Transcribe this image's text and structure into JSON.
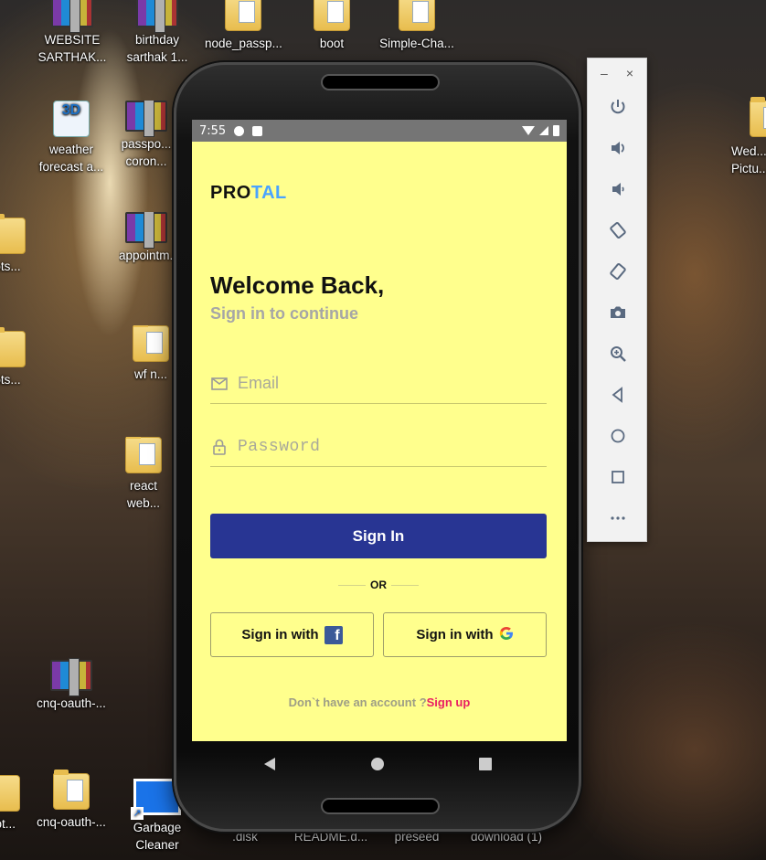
{
  "desktop": {
    "icons": [
      {
        "label": "WEBSITE SARTHAK...",
        "type": "rar"
      },
      {
        "label": "birthday sarthak 1...",
        "type": "rar"
      },
      {
        "label": "node_passp...",
        "type": "folder"
      },
      {
        "label": "boot",
        "type": "folder"
      },
      {
        "label": "Simple-Cha...",
        "type": "folder"
      },
      {
        "label": "weather forecast a...",
        "type": "app"
      },
      {
        "label": "passpo... coron...",
        "type": "rar"
      },
      {
        "label": "appointm...",
        "type": "rar"
      },
      {
        "label": "ots...",
        "type": "folder"
      },
      {
        "label": "ots...",
        "type": "folder"
      },
      {
        "label": "wf n...",
        "type": "folder"
      },
      {
        "label": "react web...",
        "type": "folder"
      },
      {
        "label": "cnq-oauth-...",
        "type": "rar"
      },
      {
        "label": "cnq-oauth-...",
        "type": "folder"
      },
      {
        "label": "oot...",
        "type": "folder"
      },
      {
        "label": "Garbage Cleaner",
        "type": "app"
      },
      {
        "label": ".disk",
        "type": "file"
      },
      {
        "label": "README.d...",
        "type": "file"
      },
      {
        "label": "preseed",
        "type": "folder"
      },
      {
        "label": "download (1)",
        "type": "file"
      },
      {
        "label": "Wed... Pictu...",
        "type": "folder"
      }
    ]
  },
  "emulator": {
    "status": {
      "time": "7:55"
    },
    "app": {
      "brand_part1": "PRO",
      "brand_part2": "TAL",
      "welcome": "Welcome Back,",
      "subtitle": "Sign in to continue",
      "email_placeholder": "Email",
      "password_placeholder": "Password",
      "signin_label": "Sign In",
      "or_label": "OR",
      "facebook_label": "Sign in with",
      "google_label": "Sign in with",
      "footer_text": "Don`t have an account ?",
      "footer_link": "Sign up"
    },
    "colors": {
      "background": "#ffff8d",
      "primary": "#283593",
      "brand_accent": "#4aa3ff",
      "link": "#e91e63"
    },
    "toolbar": {
      "minimize": "–",
      "close": "×",
      "tools": [
        "power-icon",
        "volume-up-icon",
        "volume-down-icon",
        "rotate-left-icon",
        "rotate-right-icon",
        "camera-icon",
        "zoom-icon",
        "back-icon",
        "home-icon",
        "overview-icon",
        "more-icon"
      ]
    }
  }
}
